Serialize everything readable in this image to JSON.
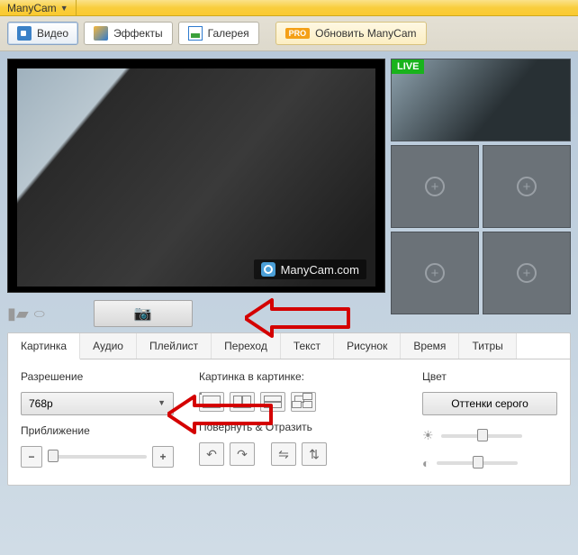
{
  "app": {
    "menu_name": "ManyCam"
  },
  "toolbar": {
    "video": "Видео",
    "effects": "Эффекты",
    "gallery": "Галерея",
    "upgrade": "Обновить ManyCam"
  },
  "preview": {
    "watermark": "ManyCam.com",
    "live_badge": "LIVE"
  },
  "ctrl_tabs": {
    "picture": "Картинка",
    "audio": "Аудио",
    "playlist": "Плейлист",
    "transition": "Переход",
    "text": "Текст",
    "drawing": "Рисунок",
    "time": "Время",
    "titles": "Титры"
  },
  "controls": {
    "resolution_label": "Разрешение",
    "resolution_value": "768p",
    "zoom_label": "Приближение",
    "pip_label": "Картинка в картинке:",
    "rotate_label": "Повернуть & Отразить",
    "color_label": "Цвет",
    "grayscale_btn": "Оттенки серого"
  }
}
